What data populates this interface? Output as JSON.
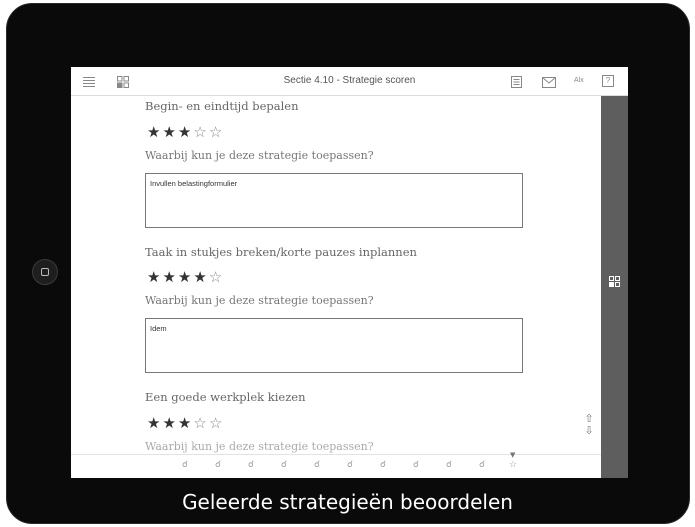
{
  "header": {
    "title": "Sectie 4.10 - Strategie scoren",
    "alx_label": "Alx",
    "help_label": "?"
  },
  "strategies": [
    {
      "title": "Begin- en eindtijd bepalen",
      "rating": 3,
      "max": 5,
      "question": "Waarbij kun je deze strategie toepassen?",
      "answer": "Invullen belastingformulier"
    },
    {
      "title": "Taak in stukjes breken/korte pauzes inplannen",
      "rating": 4,
      "max": 5,
      "question": "Waarbij kun je deze strategie toepassen?",
      "answer": "Idem"
    },
    {
      "title": "Een goede werkplek kiezen",
      "rating": 3,
      "max": 5,
      "question": "Waarbij kun je deze strategie toepassen?",
      "answer": ""
    }
  ],
  "bottom_nav": {
    "items": [
      "check",
      "check",
      "check",
      "check",
      "check",
      "check",
      "check",
      "check",
      "check",
      "check",
      "star"
    ]
  },
  "caption": "Geleerde strategieën beoordelen",
  "colors": {
    "device": "#0a0a0a",
    "sidebar": "#5e5e5e",
    "text": "#666666"
  }
}
